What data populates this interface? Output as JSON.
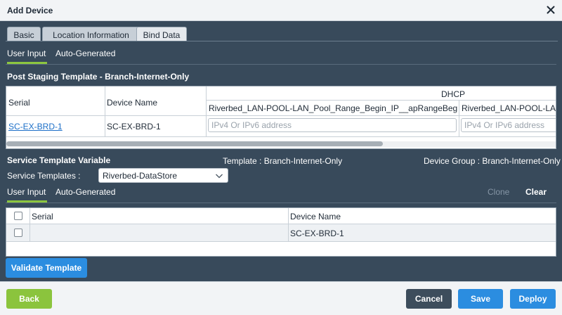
{
  "dialog": {
    "title": "Add Device"
  },
  "tabs": [
    {
      "label": "Basic"
    },
    {
      "label": "Location Information"
    },
    {
      "label": "Bind Data"
    }
  ],
  "post_staging": {
    "subtabs": [
      {
        "label": "User Input"
      },
      {
        "label": "Auto-Generated"
      }
    ],
    "title": "Post Staging Template - Branch-Internet-Only",
    "group_header": "DHCP",
    "columns": {
      "serial": "Serial",
      "device_name": "Device Name",
      "col1": "Riverbed_LAN-POOL-LAN_Pool_Range_Begin_IP__apRangeBegin",
      "col2": "Riverbed_LAN-POOL-LAN_"
    },
    "row": {
      "serial": "SC-EX-BRD-1",
      "device_name": "SC-EX-BRD-1",
      "col1_placeholder": "IPv4 Or IPv6 address",
      "col2_placeholder": "IPv4 Or IPv6 address"
    }
  },
  "service_template": {
    "title": "Service Template Variable",
    "template_label": "Template : Branch-Internet-Only",
    "device_group_label": "Device Group : Branch-Internet-Only",
    "select_label": "Service Templates :",
    "select_value": "Riverbed-DataStore",
    "subtabs": [
      {
        "label": "User Input"
      },
      {
        "label": "Auto-Generated"
      }
    ],
    "actions": {
      "clone": "Clone",
      "clear": "Clear"
    },
    "columns": {
      "serial": "Serial",
      "device_name": "Device Name"
    },
    "rows": [
      {
        "serial": "",
        "device_name": "SC-EX-BRD-1"
      }
    ],
    "validate_label": "Validate Template"
  },
  "footer": {
    "back": "Back",
    "cancel": "Cancel",
    "save": "Save",
    "deploy": "Deploy"
  },
  "colors": {
    "accent_green": "#8cc63f",
    "primary_blue": "#2b8de0",
    "panel_dark": "#384a5b",
    "link_blue": "#1c6fc8"
  }
}
